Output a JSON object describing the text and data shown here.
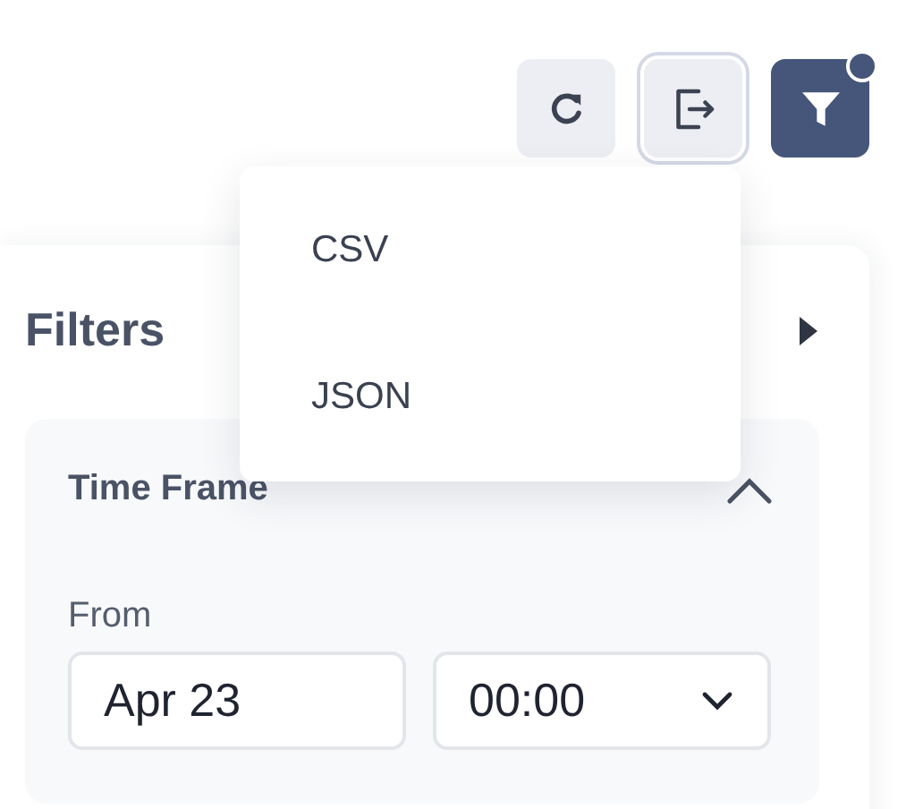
{
  "toolbar": {
    "export": {
      "expanded": true,
      "menu": [
        {
          "label": "CSV"
        },
        {
          "label": "JSON"
        }
      ]
    },
    "filter": {
      "active_dot": true
    }
  },
  "filters": {
    "title": "Filters",
    "sections": [
      {
        "title": "Time Frame",
        "expanded": true,
        "from": {
          "label": "From",
          "date": "Apr 23",
          "time": "00:00"
        }
      }
    ]
  }
}
